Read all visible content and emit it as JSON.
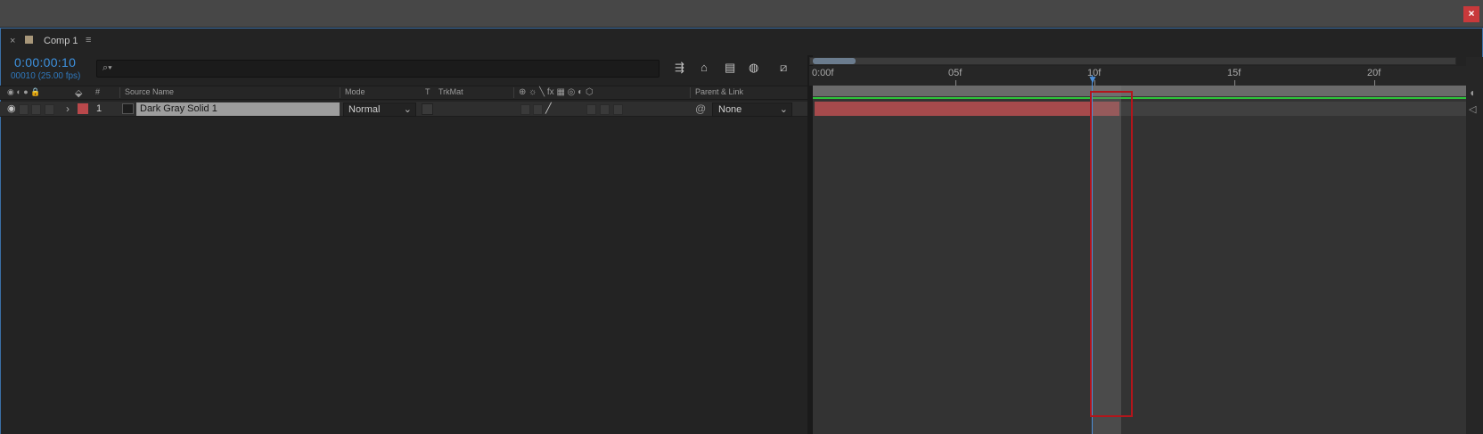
{
  "window": {
    "close_glyph": "×"
  },
  "panel": {
    "tab_close": "×",
    "tab_name": "Comp 1",
    "tab_menu": "≡",
    "timecode": "0:00:00:10",
    "frame_fps": "00010 (25.00 fps)",
    "search_icon": "⌕▾"
  },
  "toolbar": {
    "icons": [
      "draft-3d-icon",
      "shy-icon",
      "frame-blending-icon",
      "motion-blur-icon",
      "graph-editor-icon"
    ]
  },
  "columns": {
    "av_icons": "◉ ◐ ● 🔒",
    "label_icon": "tag-icon",
    "number": "#",
    "source_name": "Source Name",
    "mode": "Mode",
    "t": "T",
    "trkmat": "TrkMat",
    "switches": "⊕ ☼ ╲ fx ▦ ◎ ◐ ⬡",
    "parent_link": "Parent & Link"
  },
  "layer": {
    "number": "1",
    "name": "Dark Gray Solid 1",
    "mode": "Normal",
    "parent": "None",
    "expand": "›",
    "label_color": "#b9484b"
  },
  "ruler": {
    "ticks": [
      "0:00f",
      "05f",
      "10f",
      "15f",
      "20f"
    ],
    "current_frame": 10
  },
  "colors": {
    "timecode": "#3d92e0",
    "cti": "#4c8fd8",
    "highlight_box": "#b3151b",
    "work_area_line": "#2ec43a",
    "layer_bar": "#a64a4c"
  }
}
